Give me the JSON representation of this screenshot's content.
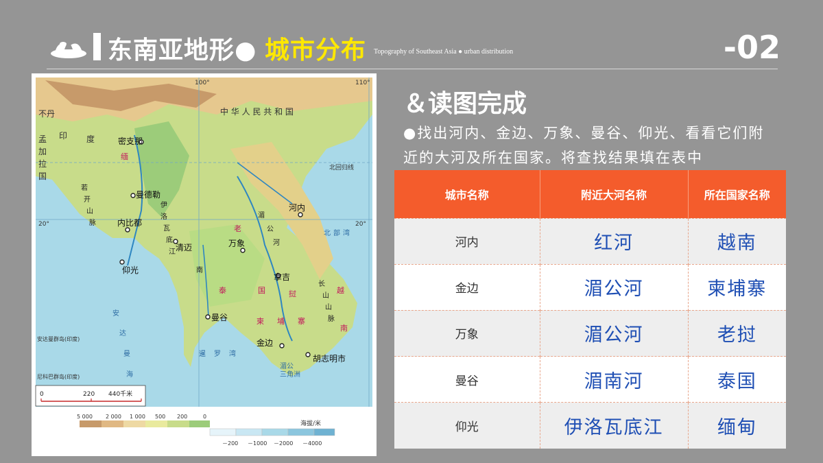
{
  "header": {
    "title_main": "东南亚地形●",
    "title_accent": "城市分布",
    "subtitle": "Topography of Southeast Asia ● urban distribution",
    "page_number": "-02"
  },
  "map": {
    "country_labels": [
      "中 华 人 民 共 和 国",
      "不丹",
      "印",
      "度",
      "孟",
      "加",
      "拉",
      "国",
      "缅",
      "泰",
      "国",
      "老",
      "挝",
      "越",
      "南",
      "柬",
      "埔",
      "寨"
    ],
    "cities": [
      "密支那",
      "曼德勒",
      "内比都",
      "仰光",
      "清迈",
      "万象",
      "河内",
      "拿吉",
      "曼谷",
      "金边",
      "胡志明市"
    ],
    "rivers_ranges": [
      "若",
      "开",
      "山",
      "脉",
      "伊",
      "洛",
      "瓦",
      "底",
      "江",
      "南",
      "湄",
      "公",
      "河",
      "长",
      "山",
      "山",
      "脉"
    ],
    "seas": [
      "安",
      "达",
      "曼",
      "海",
      "暹",
      "罗",
      "湾",
      "北",
      "部",
      "湾",
      "湄公",
      "三角洲"
    ],
    "islands": [
      "安达曼群岛(印度)",
      "尼科巴群岛(印度)"
    ],
    "graticule": [
      "100°",
      "110°",
      "20°",
      "20°",
      "北回归线"
    ],
    "scale_labels": [
      "0",
      "220",
      "440千米"
    ],
    "legend_title": "海拔/米",
    "legend_land": [
      "5 000",
      "2 000",
      "1 000",
      "500",
      "200",
      "0"
    ],
    "legend_sea": [
      "－200",
      "－1000",
      "－2000",
      "－4000"
    ]
  },
  "task": {
    "title": "＆读图完成",
    "text": "●找出河内、金边、万象、曼谷、仰光、看看它们附近的大河及所在国家。将查找结果填在表中"
  },
  "table": {
    "headers": [
      "城市名称",
      "附近大河名称",
      "所在国家名称"
    ],
    "rows": [
      {
        "city": "河内",
        "river": "红河",
        "country": "越南"
      },
      {
        "city": "金边",
        "river": "湄公河",
        "country": "柬埔寨"
      },
      {
        "city": "万象",
        "river": "湄公河",
        "country": "老挝"
      },
      {
        "city": "曼谷",
        "river": "湄南河",
        "country": "泰国"
      },
      {
        "city": "仰光",
        "river": "伊洛瓦底江",
        "country": "缅甸"
      }
    ]
  },
  "colors": {
    "background": "#959595",
    "accent_yellow": "#ffe800",
    "table_header": "#f45c2c",
    "answer_blue": "#1f4fb4"
  }
}
